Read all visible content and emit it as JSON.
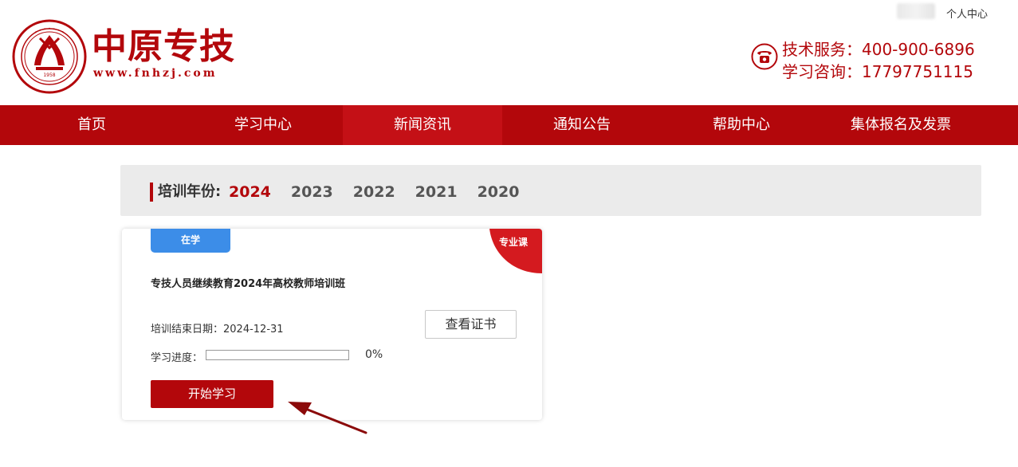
{
  "topbar": {
    "personal_center": "个人中心"
  },
  "header": {
    "logo_text": "中原专技",
    "logo_url": "www.fnhzj.com",
    "tech_service": "技术服务：400-900-6896",
    "study_consult": "学习咨询：17797751115"
  },
  "nav": {
    "items": [
      {
        "label": "首页"
      },
      {
        "label": "学习中心"
      },
      {
        "label": "新闻资讯"
      },
      {
        "label": "通知公告"
      },
      {
        "label": "帮助中心"
      },
      {
        "label": "集体报名及发票"
      }
    ],
    "active_index": 2
  },
  "year_filter": {
    "label": "培训年份:",
    "years": [
      "2024",
      "2023",
      "2022",
      "2021",
      "2020"
    ],
    "selected": "2024"
  },
  "course_card": {
    "status": "在学",
    "category": "专业课",
    "title": "专技人员继续教育2024年高校教师培训班",
    "end_date": "培训结束日期：2024-12-31",
    "view_cert": "查看证书",
    "progress_label": "学习进度：",
    "progress_value": 0,
    "progress_text": "0%",
    "start_button": "开始学习"
  },
  "colors": {
    "brand_red": "#b3070b",
    "status_blue": "#3c8de8",
    "year_bar_bg": "#ebebeb"
  },
  "icons": [
    "university-seal-logo",
    "phone-icon",
    "arrow-annotation"
  ]
}
